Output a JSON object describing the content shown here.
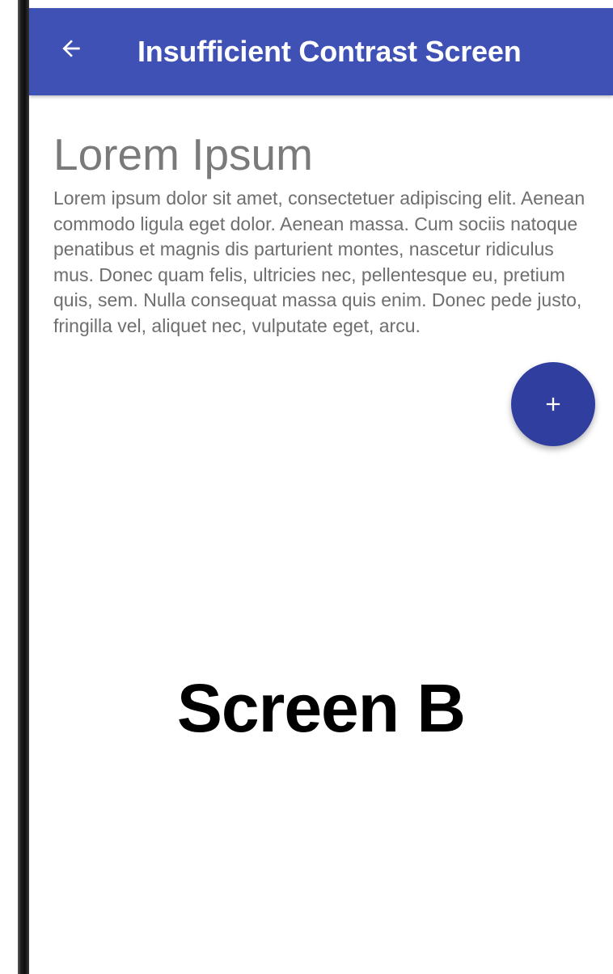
{
  "colors": {
    "app_bar": "#3f51b5",
    "fab": "#303f9f",
    "heading_text": "#7a7a7a",
    "body_text": "#6e6e6e",
    "label_text": "#000000"
  },
  "app_bar": {
    "title": "Insufficient Contrast Screen",
    "back_icon": "arrow-left-icon"
  },
  "content": {
    "heading": "Lorem Ipsum",
    "body": "Lorem ipsum dolor sit amet, consectetuer adipiscing elit. Aenean commodo ligula eget dolor. Aenean massa. Cum sociis natoque penatibus et magnis dis parturient montes, nascetur ridiculus mus. Donec quam felis, ultricies nec, pellentesque eu, pretium quis, sem. Nulla consequat massa quis enim. Donec pede justo, fringilla vel, aliquet nec, vulputate eget, arcu."
  },
  "fab": {
    "icon": "plus-icon"
  },
  "caption": {
    "label": "Screen B"
  }
}
